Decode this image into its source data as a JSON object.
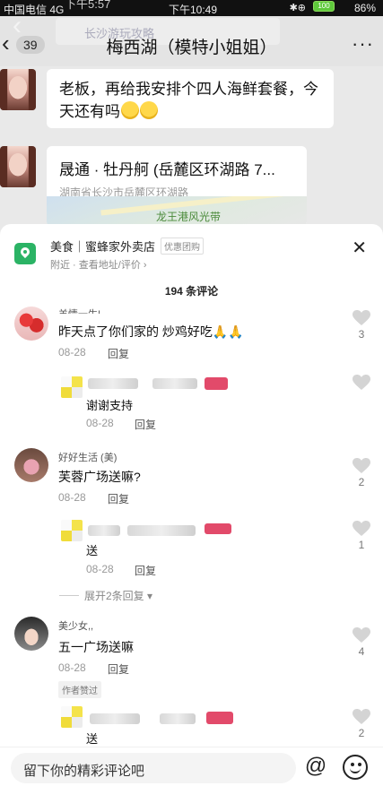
{
  "status": {
    "carrier": "中国电信  4G",
    "clock": "下午10:49",
    "ghost_clock": "下午5:57",
    "battery": "86%",
    "battery_badge": "100"
  },
  "chat": {
    "back_icon": "chevron-left-icon",
    "unread_count": "39",
    "title": "梅西湖（模特小姐姐）",
    "ghost_search": "长沙游玩攻略",
    "more_icon": "ellipsis-icon",
    "message": "老板，再给我安排个四人海鲜套餐，今天还有吗",
    "location": {
      "place": "晟通 · 牡丹舸 (岳麓区环湖路 7...",
      "address": "湖南省长沙市岳麓区环湖路",
      "map_label": "龙王港风光带"
    }
  },
  "sheet": {
    "store_name": "美食｜蜜蜂家外卖店",
    "store_tag": "优惠团购",
    "store_sub": "附近 · 查看地址/评价 ›",
    "close_icon": "close-icon",
    "comment_count": "194 条评论",
    "comments": [
      {
        "name": "羊情一生!",
        "text": "昨天点了你们家的 炒鸡好吃🙏🙏",
        "date": "08-28",
        "reply_label": "回复",
        "likes": "3",
        "reply": {
          "text": "谢谢支持",
          "date": "08-28",
          "reply_label": "回复"
        }
      },
      {
        "name": "好好生活 (美)",
        "text": "芙蓉广场送嘛?",
        "date": "08-28",
        "reply_label": "回复",
        "likes": "2",
        "reply": {
          "text": "送",
          "date": "08-28",
          "reply_label": "回复",
          "likes": "1"
        },
        "expand": "展开2条回复"
      },
      {
        "name": "美少女,,",
        "text": "五一广场送嘛",
        "date": "08-28",
        "reply_label": "回复",
        "likes": "4",
        "author_tag": "作者赞过",
        "reply": {
          "text": "送",
          "likes": "2"
        }
      }
    ]
  },
  "input": {
    "placeholder": "留下你的精彩评论吧",
    "at_symbol": "@"
  },
  "colors": {
    "accent_green": "#2bb365",
    "sheet_bg": "#ffffff",
    "chat_bg": "#e9e9e9"
  }
}
